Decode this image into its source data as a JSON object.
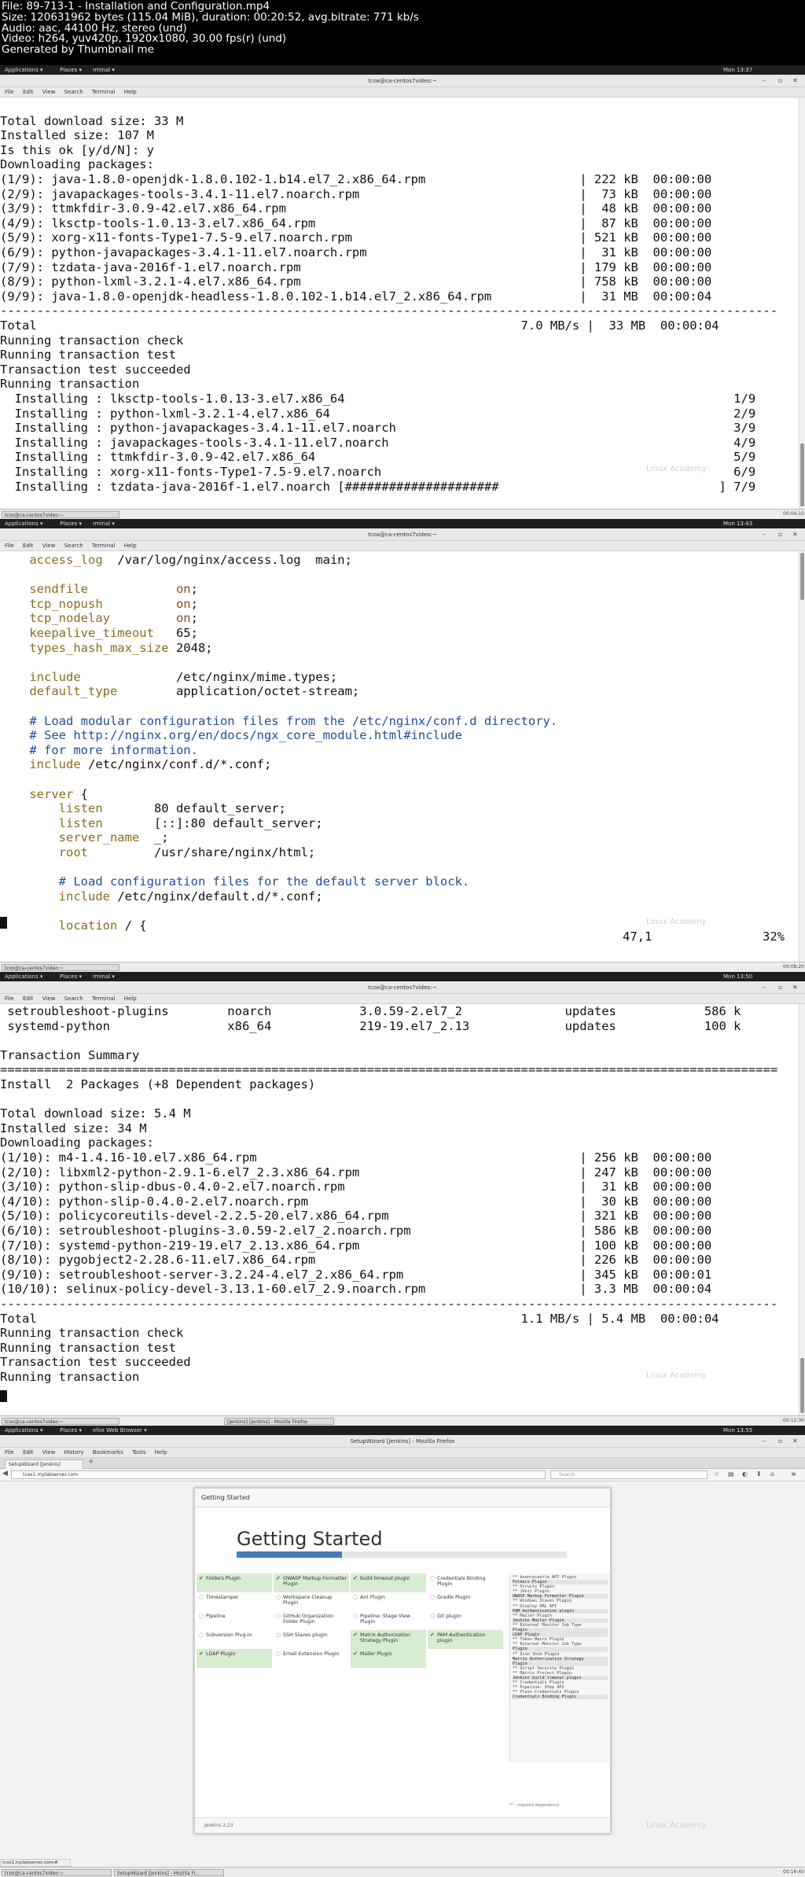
{
  "video_info": [
    "File: 89-713-1 - Installation and Configuration.mp4",
    "Size: 120631962 bytes (115.04 MiB), duration: 00:20:52, avg.bitrate: 771 kb/s",
    "Audio: aac, 44100 Hz, stereo (und)",
    "Video: h264, yuv420p, 1920x1080, 30.00 fps(r) (und)",
    "Generated by Thumbnail me"
  ],
  "desktop": {
    "applications": "Applications ▾",
    "places": "Places ▾",
    "terminal_tab": "rminal ▾",
    "firefox_tab": "efox Web Browser ▾",
    "watermark": "Linux Academy"
  },
  "frame1": {
    "clock": "Mon 13:37",
    "title": "tcox@ca-centos7video:~",
    "menu": [
      "File",
      "Edit",
      "View",
      "Search",
      "Terminal",
      "Help"
    ],
    "lines": [
      "",
      "Total download size: 33 M",
      "Installed size: 107 M",
      "Is this ok [y/d/N]: y",
      "Downloading packages:",
      "(1/9): java-1.8.0-openjdk-1.8.0.102-1.b14.el7_2.x86_64.rpm                     | 222 kB  00:00:00",
      "(2/9): javapackages-tools-3.4.1-11.el7.noarch.rpm                              |  73 kB  00:00:00",
      "(3/9): ttmkfdir-3.0.9-42.el7.x86_64.rpm                                        |  48 kB  00:00:00",
      "(4/9): lksctp-tools-1.0.13-3.el7.x86_64.rpm                                    |  87 kB  00:00:00",
      "(5/9): xorg-x11-fonts-Type1-7.5-9.el7.noarch.rpm                               | 521 kB  00:00:00",
      "(6/9): python-javapackages-3.4.1-11.el7.noarch.rpm                             |  31 kB  00:00:00",
      "(7/9): tzdata-java-2016f-1.el7.noarch.rpm                                      | 179 kB  00:00:00",
      "(8/9): python-lxml-3.2.1-4.el7.x86_64.rpm                                      | 758 kB  00:00:00",
      "(9/9): java-1.8.0-openjdk-headless-1.8.0.102-1.b14.el7_2.x86_64.rpm            |  31 MB  00:00:04",
      "----------------------------------------------------------------------------------------------------------",
      "Total                                                                  7.0 MB/s |  33 MB  00:00:04",
      "Running transaction check",
      "Running transaction test",
      "Transaction test succeeded",
      "Running transaction",
      "  Installing : lksctp-tools-1.0.13-3.el7.x86_64                                                     1/9",
      "  Installing : python-lxml-3.2.1-4.el7.x86_64                                                       2/9",
      "  Installing : python-javapackages-3.4.1-11.el7.noarch                                              3/9",
      "  Installing : javapackages-tools-3.4.1-11.el7.noarch                                               4/9",
      "  Installing : ttmkfdir-3.0.9-42.el7.x86_64                                                         5/9",
      "  Installing : xorg-x11-fonts-Type1-7.5-9.el7.noarch                                                6/9",
      "  Installing : tzdata-java-2016f-1.el7.noarch [#####################                              ] 7/9"
    ],
    "taskbar": [
      "tcox@ca-centos7video:~"
    ],
    "stamp": "00:04:10"
  },
  "frame2": {
    "clock": "Mon 13:43",
    "title": "tcox@ca-centos7video:~",
    "menu": [
      "File",
      "Edit",
      "View",
      "Search",
      "Terminal",
      "Help"
    ],
    "lines": [
      [
        {
          "c": "kw",
          "t": "    access_log"
        },
        {
          "c": "plain",
          "t": "  /var/log/nginx/access.log  main;"
        }
      ],
      [
        {
          "c": "plain",
          "t": ""
        }
      ],
      [
        {
          "c": "kw",
          "t": "    sendfile            "
        },
        {
          "c": "kv",
          "t": "on"
        },
        {
          "c": "plain",
          "t": ";"
        }
      ],
      [
        {
          "c": "kw",
          "t": "    tcp_nopush          "
        },
        {
          "c": "kv",
          "t": "on"
        },
        {
          "c": "plain",
          "t": ";"
        }
      ],
      [
        {
          "c": "kw",
          "t": "    tcp_nodelay         "
        },
        {
          "c": "kv",
          "t": "on"
        },
        {
          "c": "plain",
          "t": ";"
        }
      ],
      [
        {
          "c": "kw",
          "t": "    keepalive_timeout   "
        },
        {
          "c": "plain",
          "t": "65;"
        }
      ],
      [
        {
          "c": "kw",
          "t": "    types_hash_max_size "
        },
        {
          "c": "plain",
          "t": "2048;"
        }
      ],
      [
        {
          "c": "plain",
          "t": ""
        }
      ],
      [
        {
          "c": "kw",
          "t": "    include             "
        },
        {
          "c": "plain",
          "t": "/etc/nginx/mime.types;"
        }
      ],
      [
        {
          "c": "kw",
          "t": "    default_type        "
        },
        {
          "c": "plain",
          "t": "application/octet-stream;"
        }
      ],
      [
        {
          "c": "plain",
          "t": ""
        }
      ],
      [
        {
          "c": "cm",
          "t": "    # Load modular configuration files from the /etc/nginx/conf.d directory."
        }
      ],
      [
        {
          "c": "cm",
          "t": "    # See http://nginx.org/en/docs/ngx_core_module.html#include"
        }
      ],
      [
        {
          "c": "cm",
          "t": "    # for more information."
        }
      ],
      [
        {
          "c": "kw",
          "t": "    include "
        },
        {
          "c": "plain",
          "t": "/etc/nginx/conf.d/*.conf;"
        }
      ],
      [
        {
          "c": "plain",
          "t": ""
        }
      ],
      [
        {
          "c": "kw",
          "t": "    server "
        },
        {
          "c": "plain",
          "t": "{"
        }
      ],
      [
        {
          "c": "kw",
          "t": "        listen       "
        },
        {
          "c": "plain",
          "t": "80 default_server;"
        }
      ],
      [
        {
          "c": "kw",
          "t": "        listen       "
        },
        {
          "c": "plain",
          "t": "[::]:80 default_server;"
        }
      ],
      [
        {
          "c": "kw",
          "t": "        server_name  "
        },
        {
          "c": "plain",
          "t": "_;"
        }
      ],
      [
        {
          "c": "kw",
          "t": "        root         "
        },
        {
          "c": "plain",
          "t": "/usr/share/nginx/html;"
        }
      ],
      [
        {
          "c": "plain",
          "t": ""
        }
      ],
      [
        {
          "c": "cm",
          "t": "        # Load configuration files for the default server block."
        }
      ],
      [
        {
          "c": "kw",
          "t": "        include "
        },
        {
          "c": "plain",
          "t": "/etc/nginx/default.d/*.conf;"
        }
      ],
      [
        {
          "c": "plain",
          "t": ""
        }
      ],
      [
        {
          "c": "kw",
          "t": "        location "
        },
        {
          "c": "plain",
          "t": "/ {"
        }
      ]
    ],
    "position": "47,1",
    "percent": "32%",
    "taskbar": [
      "tcox@ca-centos7video:~"
    ],
    "stamp": "00:08:20"
  },
  "frame3": {
    "clock": "Mon 13:50",
    "title": "tcox@ca-centos7video:~",
    "menu": [
      "File",
      "Edit",
      "View",
      "Search",
      "Terminal",
      "Help"
    ],
    "lines": [
      " setroubleshoot-plugins        noarch            3.0.59-2.el7_2              updates            586 k",
      " systemd-python                x86_64            219-19.el7_2.13             updates            100 k",
      "",
      "Transaction Summary",
      "==========================================================================================================",
      "Install  2 Packages (+8 Dependent packages)",
      "",
      "Total download size: 5.4 M",
      "Installed size: 34 M",
      "Downloading packages:",
      "(1/10): m4-1.4.16-10.el7.x86_64.rpm                                            | 256 kB  00:00:00",
      "(2/10): libxml2-python-2.9.1-6.el7_2.3.x86_64.rpm                              | 247 kB  00:00:00",
      "(3/10): python-slip-dbus-0.4.0-2.el7.noarch.rpm                                |  31 kB  00:00:00",
      "(4/10): python-slip-0.4.0-2.el7.noarch.rpm                                     |  30 kB  00:00:00",
      "(5/10): policycoreutils-devel-2.2.5-20.el7.x86_64.rpm                          | 321 kB  00:00:00",
      "(6/10): setroubleshoot-plugins-3.0.59-2.el7_2.noarch.rpm                       | 586 kB  00:00:00",
      "(7/10): systemd-python-219-19.el7_2.13.x86_64.rpm                              | 100 kB  00:00:00",
      "(8/10): pygobject2-2.28.6-11.el7.x86_64.rpm                                    | 226 kB  00:00:00",
      "(9/10): setroubleshoot-server-3.2.24-4.el7_2.x86_64.rpm                        | 345 kB  00:00:01",
      "(10/10): selinux-policy-devel-3.13.1-60.el7_2.9.noarch.rpm                     | 3.3 MB  00:00:04",
      "----------------------------------------------------------------------------------------------------------",
      "Total                                                                  1.1 MB/s | 5.4 MB  00:00:04",
      "Running transaction check",
      "Running transaction test",
      "Transaction test succeeded",
      "Running transaction"
    ],
    "taskbar": [
      "tcox@ca-centos7video:~",
      "[Jenkins] [Jenkins] - Mozilla Firefox"
    ],
    "stamp": "00:12:30"
  },
  "frame4": {
    "clock": "Mon 13:55",
    "title": "SetupWizard [Jenkins] - Mozilla Firefox",
    "menu": [
      "File",
      "Edit",
      "View",
      "History",
      "Bookmarks",
      "Tools",
      "Help"
    ],
    "tab": "SetupWizard [Jenkins]",
    "url": "tcox1.mylabserver.com",
    "search_placeholder": "Search",
    "panel_header": "Getting Started",
    "heading": "Getting Started",
    "progress": 0.32,
    "plugins": [
      {
        "name": "Folders Plugin",
        "ok": true
      },
      {
        "name": "OWASP Markup Formatter Plugin",
        "ok": true
      },
      {
        "name": "build timeout plugin",
        "ok": true
      },
      {
        "name": "Credentials Binding Plugin",
        "ok": false
      },
      {
        "name": "Timestamper",
        "ok": false
      },
      {
        "name": "Workspace Cleanup Plugin",
        "ok": false
      },
      {
        "name": "Ant Plugin",
        "ok": false
      },
      {
        "name": "Gradle Plugin",
        "ok": false
      },
      {
        "name": "Pipeline",
        "ok": false
      },
      {
        "name": "GitHub Organization Folder Plugin",
        "ok": false
      },
      {
        "name": "Pipeline: Stage View Plugin",
        "ok": false
      },
      {
        "name": "Git plugin",
        "ok": false
      },
      {
        "name": "Subversion Plug-in",
        "ok": false
      },
      {
        "name": "SSH Slaves plugin",
        "ok": false
      },
      {
        "name": "Matrix Authorization Strategy Plugin",
        "ok": true
      },
      {
        "name": "PAM Authentication plugin",
        "ok": true
      },
      {
        "name": "LDAP Plugin",
        "ok": true
      },
      {
        "name": "Email Extension Plugin",
        "ok": false
      },
      {
        "name": "Mailer Plugin",
        "ok": true
      }
    ],
    "log": [
      "** bouncycastle API Plugin",
      "Folders Plugin",
      "** Structs Plugin",
      "** JUnit Plugin",
      "OWASP Markup Formatter Plugin",
      "** Windows Slaves Plugin",
      "** Display URL API",
      "PAM Authentication plugin",
      "** Mailer Plugin",
      "Jenkins Mailer Plugin",
      "** External Monitor Job Type",
      "Plugin",
      "LDAP Plugin",
      "** Token Macro Plugin",
      "** External Monitor Job Type",
      "Plugin",
      "** Icon Shim Plugin",
      "Matrix Authorization Strategy",
      "Plugin",
      "** Script Security Plugin",
      "** Matrix Project Plugin",
      "Jenkins build timeout plugin",
      "** Credentials Plugin",
      "** Pipeline: Step API",
      "** Plain Credentials Plugin",
      "Credentials Binding Plugin"
    ],
    "required_note": "** - required dependency",
    "footer": "Jenkins 2.23",
    "status_url": "tcox1.mylabserver.com/#",
    "taskbar": [
      "tcox@ca-centos7video:~",
      "SetupWizard [Jenkins] - Mozilla Fi..."
    ],
    "stamp": "00:16:40"
  }
}
